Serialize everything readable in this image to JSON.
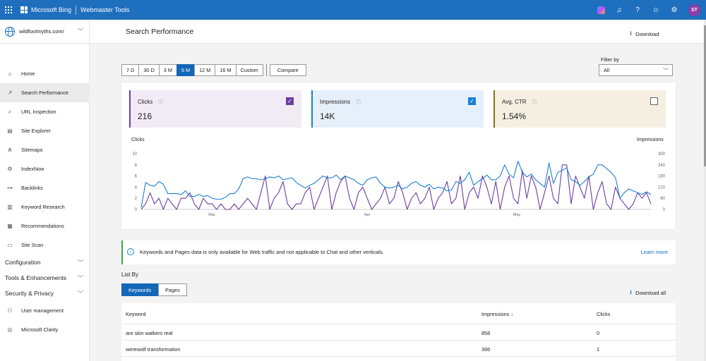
{
  "topbar": {
    "brand": "Microsoft Bing",
    "product": "Webmaster Tools",
    "avatar_initials": "ST"
  },
  "sidebar": {
    "site": "wildfootmyths.com/",
    "items": [
      {
        "icon": "home-icon",
        "glyph": "⌂",
        "label": "Home"
      },
      {
        "icon": "trend-icon",
        "glyph": "↗",
        "label": "Search Performance",
        "active": true
      },
      {
        "icon": "search-icon",
        "glyph": "⌕",
        "label": "URL Inspection"
      },
      {
        "icon": "document-icon",
        "glyph": "▤",
        "label": "Site Explorer"
      },
      {
        "icon": "sitemap-icon",
        "glyph": "⋔",
        "label": "Sitemaps"
      },
      {
        "icon": "gear-icon",
        "glyph": "⚙",
        "label": "IndexNow"
      },
      {
        "icon": "link-icon",
        "glyph": "⊶",
        "label": "Backlinks"
      },
      {
        "icon": "research-icon",
        "glyph": "▥",
        "label": "Keyword Research"
      },
      {
        "icon": "recommendations-icon",
        "glyph": "▦",
        "label": "Recommendations"
      },
      {
        "icon": "scan-icon",
        "glyph": "▭",
        "label": "Site Scan"
      }
    ],
    "groups": [
      "Configuration",
      "Tools & Enhancements",
      "Security & Privacy"
    ],
    "bottom_items": [
      {
        "icon": "user-icon",
        "glyph": "⚇",
        "label": "User management"
      },
      {
        "icon": "clarity-icon",
        "glyph": "◎",
        "label": "Microsoft Clarity"
      }
    ]
  },
  "header": {
    "title": "Search Performance",
    "download": "Download"
  },
  "ranges": [
    "7 D",
    "30 D",
    "3 M",
    "6 M",
    "12 M",
    "16 M",
    "Custom"
  ],
  "selected_range": "6 M",
  "compare": "Compare",
  "filter": {
    "label": "Filter by",
    "value": "All"
  },
  "metrics": {
    "clicks": {
      "label": "Clicks",
      "value": "216",
      "checked": true
    },
    "impressions": {
      "label": "Impressions",
      "value": "14K",
      "checked": true
    },
    "ctr": {
      "label": "Avg. CTR",
      "value": "1.54%",
      "checked": false
    }
  },
  "chart_data": {
    "type": "line",
    "left_axis_label": "Clicks",
    "right_axis_label": "Impressions",
    "left_ticks": [
      0,
      2,
      4,
      6,
      8,
      10
    ],
    "right_ticks": [
      0,
      60,
      120,
      180,
      240,
      300
    ],
    "x_labels": [
      "Mar",
      "Apr",
      "May"
    ],
    "ylim_left": [
      0,
      10
    ],
    "ylim_right": [
      0,
      300
    ],
    "series": [
      {
        "name": "Clicks",
        "color": "#6b3ea2",
        "axis": "left",
        "values": [
          0,
          1,
          3,
          1,
          2,
          0,
          2,
          1,
          0,
          2,
          2,
          3,
          1,
          0,
          2,
          1,
          1,
          0,
          1,
          0,
          0,
          1,
          0,
          1,
          2,
          1,
          0,
          3,
          6,
          0,
          2,
          3,
          5,
          1,
          0,
          1,
          1,
          3,
          4,
          0,
          2,
          4,
          6,
          0,
          3,
          5,
          6,
          2,
          0,
          3,
          4,
          2,
          0,
          1,
          2,
          4,
          1,
          2,
          5,
          3,
          0,
          2,
          3,
          1,
          2,
          4,
          0,
          2,
          3,
          5,
          1,
          2,
          6,
          0,
          3,
          4,
          2,
          6,
          4,
          1,
          5,
          0,
          4,
          6,
          2,
          1,
          7,
          2,
          6,
          4,
          0,
          3,
          6,
          2,
          1,
          8,
          8,
          1,
          6,
          4,
          2,
          6,
          0,
          3,
          5,
          1,
          0,
          4,
          2,
          1,
          0,
          1,
          3,
          2,
          3,
          1
        ]
      },
      {
        "name": "Impressions",
        "color": "#1a80d2",
        "axis": "right",
        "values": [
          10,
          145,
          130,
          125,
          150,
          135,
          85,
          85,
          85,
          80,
          100,
          70,
          70,
          80,
          70,
          75,
          60,
          55,
          55,
          65,
          85,
          85,
          110,
          165,
          175,
          165,
          165,
          160,
          165,
          175,
          170,
          180,
          160,
          165,
          170,
          145,
          130,
          115,
          130,
          140,
          160,
          180,
          170,
          170,
          185,
          160,
          180,
          170,
          160,
          140,
          130,
          160,
          170,
          175,
          140,
          120,
          115,
          120,
          130,
          110,
          120,
          140,
          150,
          130,
          120,
          135,
          110,
          120,
          115,
          100,
          105,
          150,
          140,
          160,
          200,
          130,
          150,
          165,
          185,
          160,
          160,
          180,
          240,
          190,
          170,
          260,
          200,
          175,
          190,
          160,
          140,
          120,
          250,
          140,
          200,
          210,
          225,
          160,
          150,
          130,
          150,
          175,
          190,
          240,
          240,
          220,
          200,
          170,
          60,
          90,
          110,
          100,
          90,
          80,
          95,
          80
        ]
      }
    ]
  },
  "notice": {
    "text": "Keywords and Pages data is only available for Web traffic and not applicable to Chat and other verticals.",
    "learn_more": "Learn more"
  },
  "list_by": {
    "label": "List By",
    "tabs": [
      "Keywords",
      "Pages"
    ],
    "selected": "Keywords",
    "download_all": "Download all"
  },
  "table": {
    "columns": [
      "Keyword",
      "Impressions",
      "Clicks"
    ],
    "rows": [
      [
        "are skin walkers real",
        "858",
        "0"
      ],
      [
        "werewolf transformation",
        "396",
        "1"
      ]
    ]
  }
}
